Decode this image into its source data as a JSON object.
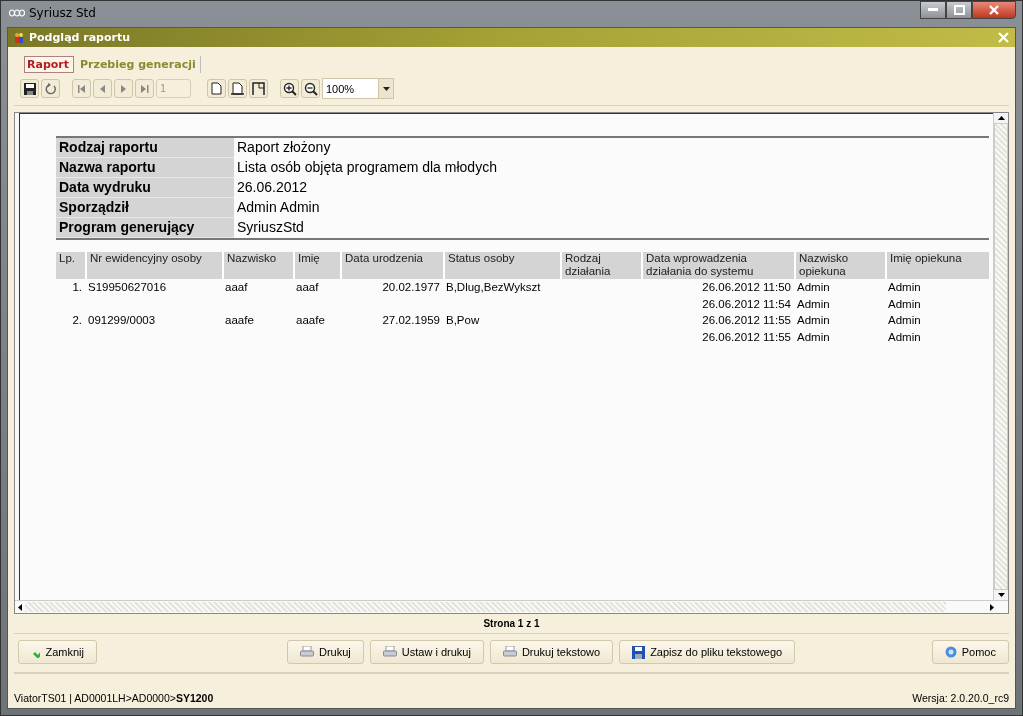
{
  "window": {
    "title": "Syriusz Std"
  },
  "dialog": {
    "title": "Podgląd raportu"
  },
  "tabs": [
    {
      "label": "Raport",
      "selected": true
    },
    {
      "label": "Przebieg generacji",
      "selected": false
    }
  ],
  "toolbar": {
    "page": "1",
    "zoom": "100%"
  },
  "report": {
    "info": [
      {
        "label": "Rodzaj raportu",
        "value": "Raport złożony"
      },
      {
        "label": "Nazwa raportu",
        "value": "Lista osób objęta programem dla młodych"
      },
      {
        "label": "Data wydruku",
        "value": "26.06.2012"
      },
      {
        "label": "Sporządził",
        "value": "Admin Admin"
      },
      {
        "label": "Program generujący",
        "value": "SyriuszStd"
      }
    ],
    "columns": [
      "Lp.",
      "Nr ewidencyjny osoby",
      "Nazwisko",
      "Imię",
      "Data urodzenia",
      "Status osoby",
      "Rodzaj działania",
      "Data wprowadzenia działania do systemu",
      "Nazwisko opiekuna",
      "Imię opiekuna"
    ],
    "rows": [
      {
        "lp": "1.",
        "nr": "S19950627016",
        "nazwisko": "aaaf",
        "imie": "aaaf",
        "data_urodzenia": "20.02.1977",
        "status": "B,Dlug,BezWykszt",
        "data_wprowadzenia": "26.06.2012 11:50",
        "nazwisko_opiekuna": "Admin",
        "imie_opiekuna": "Admin"
      },
      {
        "data_wprowadzenia": "26.06.2012 11:54",
        "nazwisko_opiekuna": "Admin",
        "imie_opiekuna": "Admin"
      },
      {
        "lp": "2.",
        "nr": "091299/0003",
        "nazwisko": "aaafe",
        "imie": "aaafe",
        "data_urodzenia": "27.02.1959",
        "status": "B,Pow",
        "data_wprowadzenia": "26.06.2012 11:55",
        "nazwisko_opiekuna": "Admin",
        "imie_opiekuna": "Admin"
      },
      {
        "data_wprowadzenia": "26.06.2012 11:55",
        "nazwisko_opiekuna": "Admin",
        "imie_opiekuna": "Admin"
      }
    ]
  },
  "page_indicator": "Strona 1 z 1",
  "buttons": {
    "close": "Zamknij",
    "print": "Drukuj",
    "setup_print": "Ustaw i drukuj",
    "print_text": "Drukuj tekstowo",
    "save_text": "Zapisz do pliku tekstowego",
    "help": "Pomoc"
  },
  "status_bar": {
    "path": "ViatorTS01 | AD0001LH>AD0000>**SY1200**",
    "version": "Wersja: 2.0.20.0_rc9"
  }
}
